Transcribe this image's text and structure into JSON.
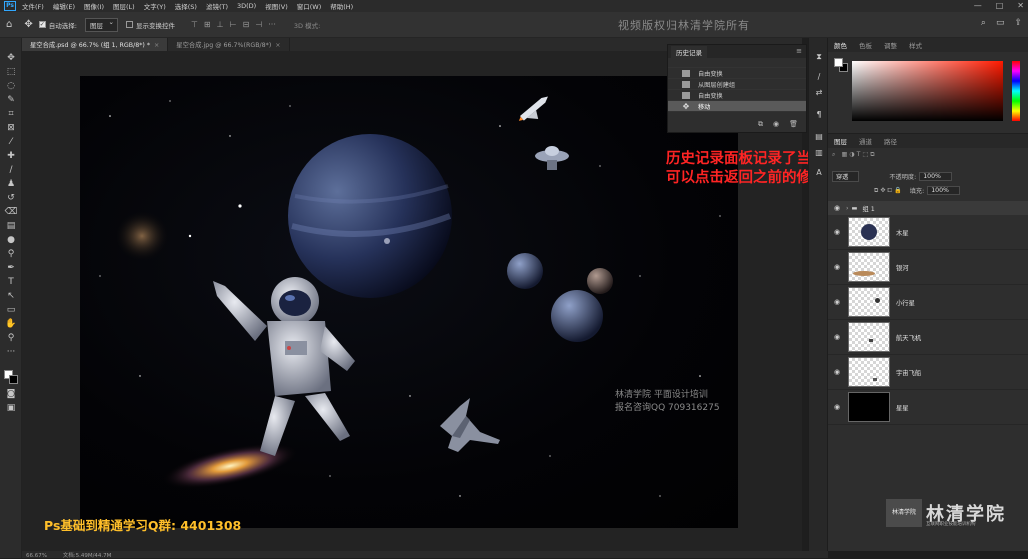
{
  "menubar": {
    "logo": "Ps",
    "items": [
      "文件(F)",
      "编辑(E)",
      "图像(I)",
      "图层(L)",
      "文字(Y)",
      "选择(S)",
      "滤镜(T)",
      "3D(D)",
      "视图(V)",
      "窗口(W)",
      "帮助(H)"
    ],
    "window_controls": [
      "—",
      "□",
      "✕"
    ]
  },
  "options": {
    "auto_select_label": "自动选择:",
    "auto_select_value": "图层",
    "show_transform_label": "显示变换控件",
    "mode3d_label": "3D 模式:",
    "watermark": "视频版权归林清学院所有"
  },
  "tabs": [
    {
      "label": "星空合成.psd @ 66.7% (组 1, RGB/8*) *",
      "active": true
    },
    {
      "label": "星空合成.jpg @ 66.7%(RGB/8*)",
      "active": false
    }
  ],
  "history": {
    "title": "历史记录",
    "rows": [
      {
        "label": "自由变换",
        "selected": false
      },
      {
        "label": "从图层创建组",
        "selected": false
      },
      {
        "label": "自由变换",
        "selected": false
      },
      {
        "label": "移动",
        "selected": true
      }
    ]
  },
  "annotation": {
    "line1": "历史记录面板记录了当前的所有操作",
    "line2": "可以点击返回之前的修改",
    "color": "#ff2424"
  },
  "color_panel": {
    "tabs": [
      "颜色",
      "色板",
      "调整",
      "样式"
    ],
    "active_tab": "颜色",
    "hue_color": "#ff1a00"
  },
  "layers_panel": {
    "tabs": [
      "图层",
      "通道",
      "路径"
    ],
    "active_tab": "图层",
    "blend_mode": "穿透",
    "opacity_label": "不透明度:",
    "opacity_value": "100%",
    "fill_label": "填充:",
    "fill_value": "100%",
    "group_name": "组 1",
    "layers": [
      {
        "name": "木星"
      },
      {
        "name": "银河"
      },
      {
        "name": "小行星"
      },
      {
        "name": "航天飞机"
      },
      {
        "name": "宇宙飞船"
      },
      {
        "name": "星星"
      }
    ]
  },
  "canvas_watermark": {
    "line1": "林清学院   平面设计培训",
    "line2": "报名咨询QQ 709316275"
  },
  "promo": {
    "qq_group": "Ps基础到精通学习Q群: 4401308",
    "color": "#ffbf2a"
  },
  "brand": {
    "name": "林清学院",
    "box": "林清学院",
    "slogan": "互联网职业技能培训机构"
  },
  "status": {
    "zoom": "66.67%",
    "doc": "文档:5.49M/44.7M"
  }
}
